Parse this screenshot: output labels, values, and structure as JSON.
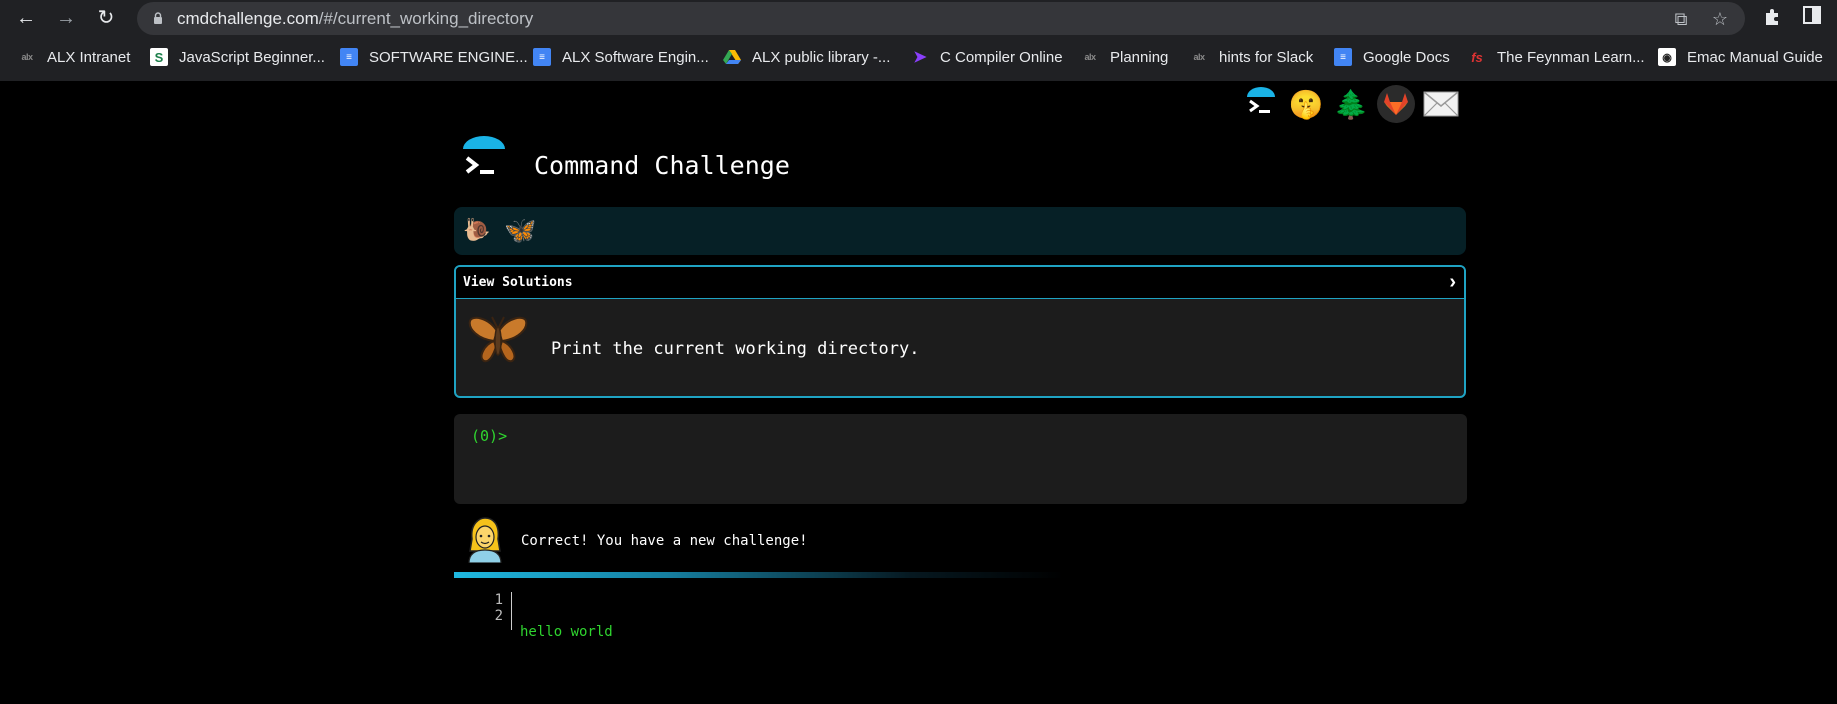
{
  "browser": {
    "url_host": "cmdchallenge.com",
    "url_path": "/#/current_working_directory",
    "icons": [
      "back-icon",
      "forward-icon",
      "reload-icon",
      "lock-icon",
      "share-icon",
      "star-icon",
      "extensions-icon",
      "sidebar-icon"
    ],
    "bookmarks": [
      {
        "label": "ALX Intranet",
        "icon": "alx"
      },
      {
        "label": "JavaScript Beginner...",
        "icon": "js"
      },
      {
        "label": "SOFTWARE ENGINE...",
        "icon": "doc"
      },
      {
        "label": "ALX Software Engin...",
        "icon": "doc"
      },
      {
        "label": "ALX public library -...",
        "icon": "drive"
      },
      {
        "label": "C Compiler Online",
        "icon": "cc"
      },
      {
        "label": "Planning",
        "icon": "alx"
      },
      {
        "label": "hints for Slack",
        "icon": "alx"
      },
      {
        "label": "Google Docs",
        "icon": "doc"
      },
      {
        "label": "The Feynman Learn...",
        "icon": "fs"
      },
      {
        "label": "Emac Manual Guide",
        "icon": "emac"
      }
    ]
  },
  "app": {
    "title": "Command Challenge",
    "header_icons": [
      "terminal-icon",
      "shushing-face-icon",
      "tree-icon",
      "gitlab-icon",
      "envelope-icon"
    ]
  },
  "progress": {
    "icons": [
      "snail-icon",
      "butterfly-icon"
    ]
  },
  "challenge": {
    "view_solutions_label": "View Solutions",
    "description": "Print the current working directory."
  },
  "terminal": {
    "prompt": "(0)>"
  },
  "feedback": {
    "message": "Correct! You have a new challenge!"
  },
  "output": {
    "line_numbers": [
      "1",
      "2"
    ],
    "lines": [
      "hello world",
      ""
    ]
  },
  "colors": {
    "accent": "#1fa3c3",
    "prompt_green": "#2fd52f",
    "progress_bg": "#062026"
  }
}
